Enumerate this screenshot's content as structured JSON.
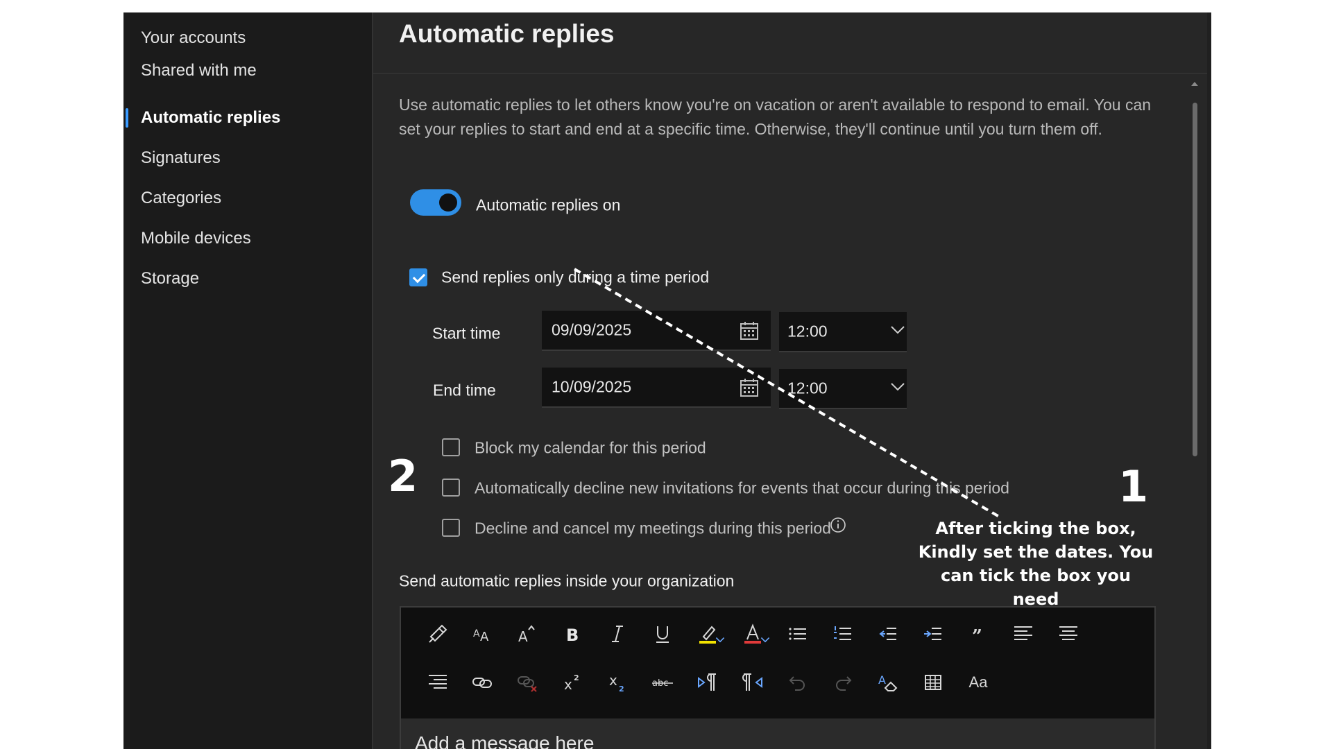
{
  "sidebar": {
    "items": [
      {
        "label": "Your accounts",
        "active": false
      },
      {
        "label": "Shared with me",
        "active": false
      },
      {
        "label": "Automatic replies",
        "active": true
      },
      {
        "label": "Signatures",
        "active": false
      },
      {
        "label": "Categories",
        "active": false
      },
      {
        "label": "Mobile devices",
        "active": false
      },
      {
        "label": "Storage",
        "active": false
      }
    ]
  },
  "main": {
    "title": "Automatic replies",
    "description": "Use automatic replies to let others know you're on vacation or aren't available to respond to email. You can set your replies to start and end at a specific time. Otherwise, they'll continue until you turn them off.",
    "toggle": {
      "label": "Automatic replies on",
      "on": true
    },
    "time_period": {
      "label": "Send replies only during a time period",
      "checked": true
    },
    "start": {
      "label": "Start time",
      "date": "09/09/2025",
      "time": "12:00"
    },
    "end": {
      "label": "End time",
      "date": "10/09/2025",
      "time": "12:00"
    },
    "options": [
      {
        "label": "Block my calendar for this period",
        "checked": false
      },
      {
        "label": "Automatically decline new invitations for events that occur during this period",
        "checked": false
      },
      {
        "label": "Decline and cancel my meetings during this period",
        "checked": false
      }
    ],
    "inside_org_title": "Send automatic replies inside your organization",
    "editor": {
      "placeholder": "Add a message here",
      "toolbar_row1": [
        "format-painter-icon",
        "font-size-icon",
        "grow-font-icon",
        "bold-icon",
        "italic-icon",
        "underline-icon",
        "highlight-icon",
        "font-color-icon",
        "bullets-icon",
        "numbering-icon",
        "decrease-indent-icon",
        "increase-indent-icon",
        "quote-icon",
        "align-left-icon",
        "align-center-icon"
      ],
      "toolbar_row2": [
        "align-right-icon",
        "insert-link-icon",
        "remove-link-icon",
        "superscript-icon",
        "subscript-icon",
        "strikethrough-icon",
        "ltr-icon",
        "rtl-icon",
        "undo-icon",
        "redo-icon",
        "clear-formatting-icon",
        "insert-table-icon",
        "change-case-icon"
      ],
      "case_label": "Aa"
    }
  },
  "annotations": {
    "number1": "1",
    "number2": "2",
    "note": "After ticking the box, Kindly set the dates. You can tick the box  you need"
  },
  "colors": {
    "accent": "#2f8fe6",
    "sidebar_bg": "#1b1b1b",
    "panel_bg": "#272727",
    "highlight_yellow": "#f2e200",
    "font_red": "#e03a3a"
  }
}
